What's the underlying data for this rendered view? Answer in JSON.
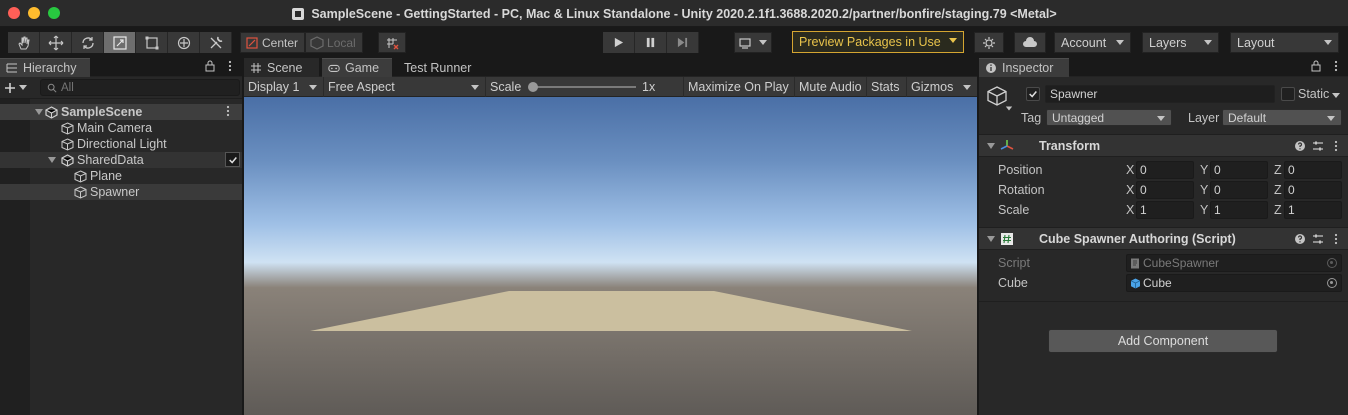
{
  "window": {
    "title": "SampleScene - GettingStarted - PC, Mac & Linux Standalone - Unity 2020.2.1f1.3688.2020.2/partner/bonfire/staging.79 <Metal>"
  },
  "toolbar": {
    "tools": [
      "hand-tool",
      "move-tool",
      "rotate-tool",
      "scale-tool",
      "rect-tool",
      "transform-tool",
      "custom-tool"
    ],
    "active_tool": "scale-tool",
    "pivot_label": "Center",
    "space_label": "Local",
    "preview_packages_label": "Preview Packages in Use",
    "account_label": "Account",
    "layers_label": "Layers",
    "layout_label": "Layout",
    "accent_color": "#d4a531"
  },
  "hierarchy": {
    "tab_label": "Hierarchy",
    "search_placeholder": "All",
    "scene": "SampleScene",
    "items": [
      {
        "label": "Main Camera",
        "depth": 1
      },
      {
        "label": "Directional Light",
        "depth": 1
      },
      {
        "label": "SharedData",
        "depth": 1
      },
      {
        "label": "Plane",
        "depth": 2
      },
      {
        "label": "Spawner",
        "depth": 2
      }
    ]
  },
  "center": {
    "tabs": [
      {
        "label": "Scene"
      },
      {
        "label": "Game"
      },
      {
        "label": "Test Runner"
      }
    ],
    "active_tab": "Game",
    "display_label": "Display 1",
    "aspect_label": "Free Aspect",
    "scale_label": "Scale",
    "scale_value": "1x",
    "maximize_label": "Maximize On Play",
    "mute_label": "Mute Audio",
    "stats_label": "Stats",
    "gizmos_label": "Gizmos"
  },
  "inspector": {
    "tab_label": "Inspector",
    "object_name": "Spawner",
    "static_label": "Static",
    "tag_label": "Tag",
    "tag_value": "Untagged",
    "layer_label": "Layer",
    "layer_value": "Default",
    "transform": {
      "title": "Transform",
      "rows": [
        {
          "label": "Position",
          "x": "0",
          "y": "0",
          "z": "0"
        },
        {
          "label": "Rotation",
          "x": "0",
          "y": "0",
          "z": "0"
        },
        {
          "label": "Scale",
          "x": "1",
          "y": "1",
          "z": "1"
        }
      ],
      "axes": [
        "X",
        "Y",
        "Z"
      ]
    },
    "script_component": {
      "title": "Cube Spawner Authoring (Script)",
      "script_label": "Script",
      "script_value": "CubeSpawner",
      "cube_label": "Cube",
      "cube_value": "Cube"
    },
    "add_component_label": "Add Component"
  }
}
